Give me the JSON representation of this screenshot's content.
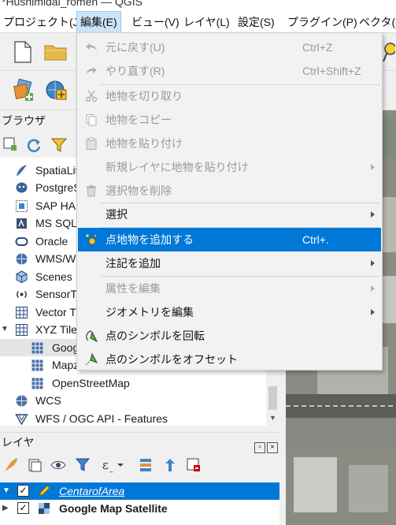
{
  "window": {
    "title": "*Hushimidai_romen — QGIS"
  },
  "menubar": {
    "items": [
      {
        "label": "プロジェクト(J)"
      },
      {
        "label": "編集(E)"
      },
      {
        "label": "ビュー(V)"
      },
      {
        "label": "レイヤ(L)"
      },
      {
        "label": "設定(S)"
      },
      {
        "label": "プラグイン(P)"
      },
      {
        "label": "ベクタ(O)"
      }
    ]
  },
  "edit_menu": {
    "items": [
      {
        "label": "元に戻す(U)",
        "shortcut": "Ctrl+Z",
        "icon": "undo-icon",
        "enabled": false
      },
      {
        "label": "やり直す(R)",
        "shortcut": "Ctrl+Shift+Z",
        "icon": "redo-icon",
        "enabled": false
      },
      {
        "label": "地物を切り取り",
        "shortcut": "",
        "icon": "cut-icon",
        "enabled": false
      },
      {
        "label": "地物をコピー",
        "shortcut": "",
        "icon": "copy-icon",
        "enabled": false
      },
      {
        "label": "地物を貼り付け",
        "shortcut": "",
        "icon": "paste-icon",
        "enabled": false
      },
      {
        "label": "新規レイヤに地物を貼り付け",
        "shortcut": "",
        "icon": "",
        "enabled": false,
        "submenu": true
      },
      {
        "label": "選択物を削除",
        "shortcut": "",
        "icon": "delete-icon",
        "enabled": false
      },
      {
        "label": "選択",
        "shortcut": "",
        "icon": "",
        "enabled": true,
        "submenu": true
      },
      {
        "label": "点地物を追加する",
        "shortcut": "Ctrl+.",
        "icon": "add-point-icon",
        "enabled": true,
        "highlighted": true
      },
      {
        "label": "注記を追加",
        "shortcut": "",
        "icon": "",
        "enabled": true,
        "submenu": true
      },
      {
        "label": "属性を編集",
        "shortcut": "",
        "icon": "",
        "enabled": false,
        "submenu": true
      },
      {
        "label": "ジオメトリを編集",
        "shortcut": "",
        "icon": "",
        "enabled": true,
        "submenu": true
      },
      {
        "label": "点のシンボルを回転",
        "shortcut": "",
        "icon": "rotate-symbol-icon",
        "enabled": true
      },
      {
        "label": "点のシンボルをオフセット",
        "shortcut": "",
        "icon": "offset-symbol-icon",
        "enabled": true
      }
    ]
  },
  "browser": {
    "title": "ブラウザ",
    "items": [
      {
        "label": "SpatiaLite",
        "icon": "spatialite-icon",
        "indent": 1
      },
      {
        "label": "PostgreSQL",
        "icon": "postgresql-icon",
        "indent": 1
      },
      {
        "label": "SAP HANA",
        "icon": "sap-hana-icon",
        "indent": 1
      },
      {
        "label": "MS SQL Server",
        "icon": "mssql-icon",
        "indent": 1
      },
      {
        "label": "Oracle",
        "icon": "oracle-icon",
        "indent": 1
      },
      {
        "label": "WMS/WMTS",
        "icon": "wms-icon",
        "indent": 1
      },
      {
        "label": "Scenes",
        "icon": "scenes-icon",
        "indent": 1
      },
      {
        "label": "SensorThings",
        "icon": "sensorthings-icon",
        "indent": 1
      },
      {
        "label": "Vector Tiles",
        "icon": "vector-tiles-icon",
        "indent": 1
      },
      {
        "label": "XYZ Tiles",
        "icon": "xyz-tiles-icon",
        "indent": 1,
        "expanded": true
      },
      {
        "label": "Google Map Satellite",
        "icon": "tile-grid-icon",
        "indent": 2,
        "selected": true
      },
      {
        "label": "Mapzen Global Terrain",
        "icon": "tile-grid-icon",
        "indent": 2
      },
      {
        "label": "OpenStreetMap",
        "icon": "tile-grid-icon",
        "indent": 2
      },
      {
        "label": "WCS",
        "icon": "wcs-icon",
        "indent": 1
      },
      {
        "label": "WFS / OGC API - Features",
        "icon": "wfs-icon",
        "indent": 1
      }
    ]
  },
  "layers": {
    "title": "レイヤ",
    "items": [
      {
        "label": "CentarofArea",
        "checked": true,
        "selected": true,
        "icon": "edit-pencil-icon"
      },
      {
        "label": "Google Map Satellite",
        "checked": true,
        "selected": false,
        "icon": "raster-tile-icon"
      }
    ]
  },
  "colors": {
    "highlight": "#0078d7",
    "menu_active": "#cce4f7"
  }
}
